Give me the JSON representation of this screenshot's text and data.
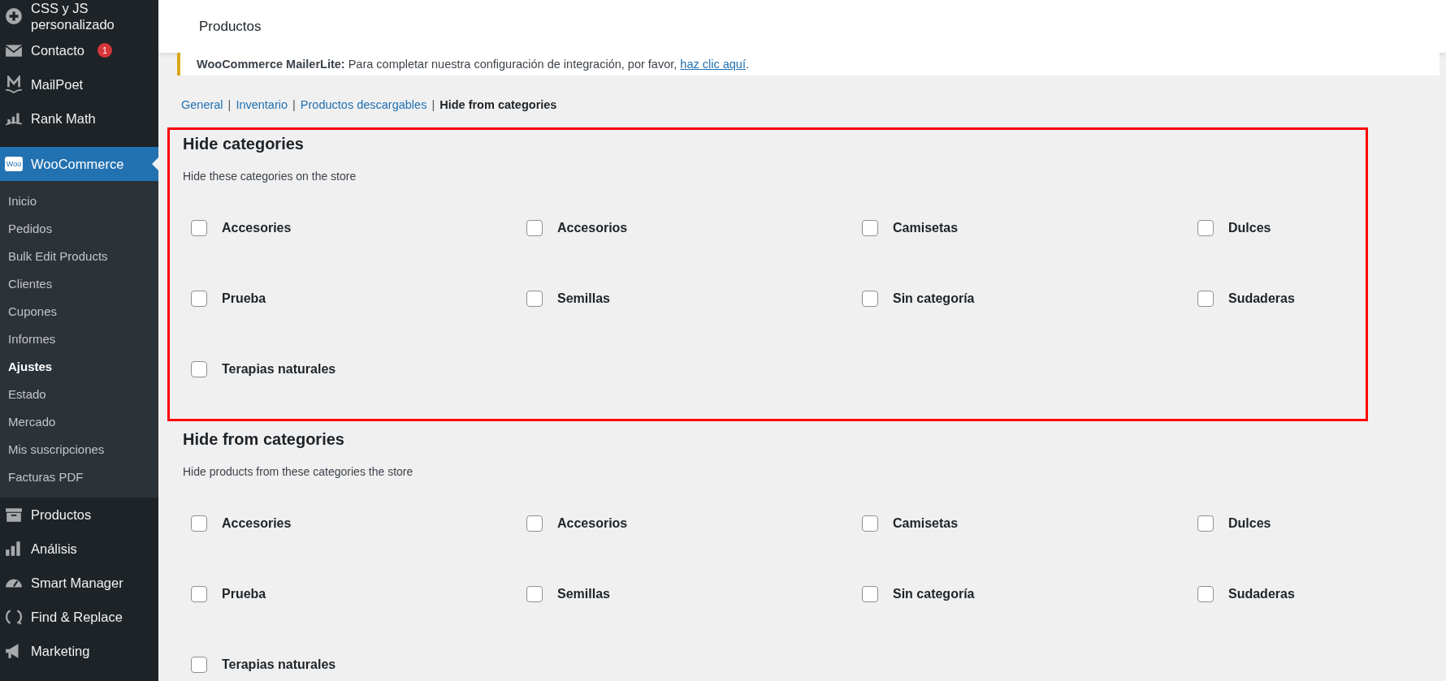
{
  "sidebar": {
    "items": [
      {
        "label": "CSS y JS personalizado",
        "kind": "plus",
        "selected": false
      },
      {
        "label": "Contacto",
        "kind": "mail",
        "badge": "1",
        "selected": false
      },
      {
        "label": "MailPoet",
        "kind": "m",
        "selected": false
      },
      {
        "label": "Rank Math",
        "kind": "rank",
        "selected": false
      },
      {
        "label": "WooCommerce",
        "kind": "woo",
        "logo_text": "Woo",
        "selected": true,
        "children": [
          {
            "label": "Inicio",
            "selected": false
          },
          {
            "label": "Pedidos",
            "selected": false
          },
          {
            "label": "Bulk Edit Products",
            "selected": false
          },
          {
            "label": "Clientes",
            "selected": false
          },
          {
            "label": "Cupones",
            "selected": false
          },
          {
            "label": "Informes",
            "selected": false
          },
          {
            "label": "Ajustes",
            "selected": true
          },
          {
            "label": "Estado",
            "selected": false
          },
          {
            "label": "Mercado",
            "selected": false
          },
          {
            "label": "Mis suscripciones",
            "selected": false
          },
          {
            "label": "Facturas PDF",
            "selected": false
          }
        ]
      },
      {
        "label": "Productos",
        "kind": "box",
        "selected": false
      },
      {
        "label": "Análisis",
        "kind": "bars",
        "selected": false
      },
      {
        "label": "Smart Manager",
        "kind": "gauge",
        "selected": false
      },
      {
        "label": "Find & Replace",
        "kind": "cycle",
        "selected": false
      },
      {
        "label": "Marketing",
        "kind": "megaphone",
        "selected": false
      }
    ]
  },
  "header": {
    "title": "Productos"
  },
  "notice": {
    "text": "**WooCommerce MailerLite:** Para completar nuestra configuración de integración, por favor, ",
    "link": "haz clic aquí",
    "end": "."
  },
  "subnav": [
    {
      "label": "General",
      "selected": false
    },
    {
      "separator": "|",
      "label": "Inventario",
      "selected": false
    },
    {
      "separator": "|",
      "label": "Productos descargables",
      "selected": false
    },
    {
      "separator": "|",
      "label": "Hide from categories",
      "selected": true
    }
  ],
  "sections": [
    {
      "title": "Hide categories",
      "description": "Hide these categories on the store",
      "highlighted": true,
      "options": [
        {
          "label": "Accesories",
          "checked": false
        },
        {
          "label": "Accesorios",
          "checked": false
        },
        {
          "label": "Camisetas",
          "checked": false
        },
        {
          "label": "Dulces",
          "checked": false
        },
        {
          "label": "Prueba",
          "checked": false
        },
        {
          "label": "Semillas",
          "checked": false
        },
        {
          "label": "Sin categoría",
          "checked": false
        },
        {
          "label": "Sudaderas",
          "checked": false
        },
        {
          "label": "Terapias naturales",
          "checked": false
        }
      ]
    },
    {
      "title": "Hide from categories",
      "description": "Hide products from these categories the store",
      "highlighted": false,
      "options": [
        {
          "label": "Accesories",
          "checked": false
        },
        {
          "label": "Accesorios",
          "checked": false
        },
        {
          "label": "Camisetas",
          "checked": false
        },
        {
          "label": "Dulces",
          "checked": false
        },
        {
          "label": "Prueba",
          "checked": false
        },
        {
          "label": "Semillas",
          "checked": false
        },
        {
          "label": "Sin categoría",
          "checked": false
        },
        {
          "label": "Sudaderas",
          "checked": false
        },
        {
          "label": "Terapias naturales",
          "checked": false
        }
      ]
    }
  ]
}
